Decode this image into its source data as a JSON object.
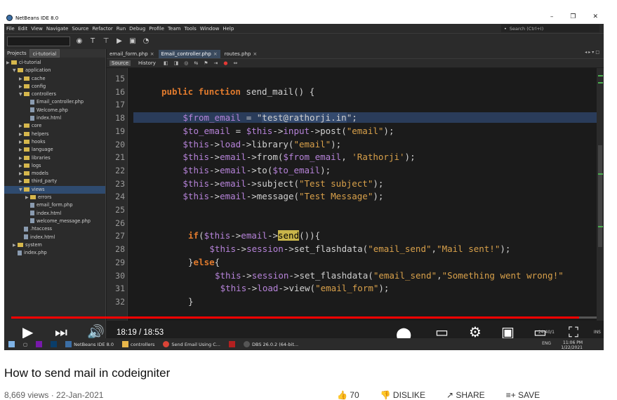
{
  "window": {
    "title": "NetBeans IDE 8.0",
    "controls": [
      "–",
      "❐",
      "✕"
    ]
  },
  "menu": [
    "File",
    "Edit",
    "View",
    "Navigate",
    "Source",
    "Refactor",
    "Run",
    "Debug",
    "Profile",
    "Team",
    "Tools",
    "Window",
    "Help"
  ],
  "search": {
    "placeholder": "Search (Ctrl+I)"
  },
  "sidebar": {
    "tabs": [
      "Projects",
      "ci-tutorial"
    ],
    "tree": [
      {
        "label": "ci-tutorial",
        "depth": 0,
        "type": "project"
      },
      {
        "label": "application",
        "depth": 1,
        "type": "folder",
        "open": true
      },
      {
        "label": "cache",
        "depth": 2,
        "type": "folder"
      },
      {
        "label": "config",
        "depth": 2,
        "type": "folder"
      },
      {
        "label": "controllers",
        "depth": 2,
        "type": "folder",
        "open": true
      },
      {
        "label": "Email_controller.php",
        "depth": 3,
        "type": "file"
      },
      {
        "label": "Welcome.php",
        "depth": 3,
        "type": "file"
      },
      {
        "label": "index.html",
        "depth": 3,
        "type": "file"
      },
      {
        "label": "core",
        "depth": 2,
        "type": "folder"
      },
      {
        "label": "helpers",
        "depth": 2,
        "type": "folder"
      },
      {
        "label": "hooks",
        "depth": 2,
        "type": "folder"
      },
      {
        "label": "language",
        "depth": 2,
        "type": "folder"
      },
      {
        "label": "libraries",
        "depth": 2,
        "type": "folder"
      },
      {
        "label": "logs",
        "depth": 2,
        "type": "folder"
      },
      {
        "label": "models",
        "depth": 2,
        "type": "folder"
      },
      {
        "label": "third_party",
        "depth": 2,
        "type": "folder"
      },
      {
        "label": "views",
        "depth": 2,
        "type": "folder",
        "open": true,
        "selected": true
      },
      {
        "label": "errors",
        "depth": 3,
        "type": "folder"
      },
      {
        "label": "email_form.php",
        "depth": 3,
        "type": "file"
      },
      {
        "label": "index.html",
        "depth": 3,
        "type": "file"
      },
      {
        "label": "welcome_message.php",
        "depth": 3,
        "type": "file"
      },
      {
        "label": ".htaccess",
        "depth": 2,
        "type": "file"
      },
      {
        "label": "index.html",
        "depth": 2,
        "type": "file"
      },
      {
        "label": "system",
        "depth": 1,
        "type": "folder"
      },
      {
        "label": "index.php",
        "depth": 1,
        "type": "file"
      }
    ]
  },
  "editor": {
    "file_tabs": [
      "email_form.php",
      "Email_controller.php",
      "routes.php"
    ],
    "active_tab": "Email_controller.php",
    "view_tabs": [
      "Source",
      "History"
    ],
    "line_numbers": [
      "15",
      "16",
      "17",
      "18",
      "19",
      "20",
      "21",
      "22",
      "23",
      "24",
      "25",
      "26",
      "27",
      "28",
      "29",
      "30",
      "31",
      "32"
    ]
  },
  "video": {
    "time": "18:19 / 18:53",
    "progress_fraction": 0.97,
    "title": "How to send mail in codeigniter",
    "views": "8,669 views · 22-Jan-2021",
    "actions": [
      "70",
      "DISLIKE",
      "SHARE",
      "SAVE"
    ]
  },
  "taskbar": {
    "items": [
      "NetBeans IDE 8.0",
      "controllers",
      "Send Email Using C...",
      "DBS 26.0.2 (64-bit..."
    ],
    "clock_time": "11:06 PM",
    "clock_date": "1/22/2021",
    "lang": "ENG",
    "ins": "INS",
    "cursor": "24:40/1"
  },
  "colors": {
    "keyword": "#e07a2d",
    "variable": "#b683d9",
    "string": "#d8a04a",
    "progress": "#ff0000"
  }
}
